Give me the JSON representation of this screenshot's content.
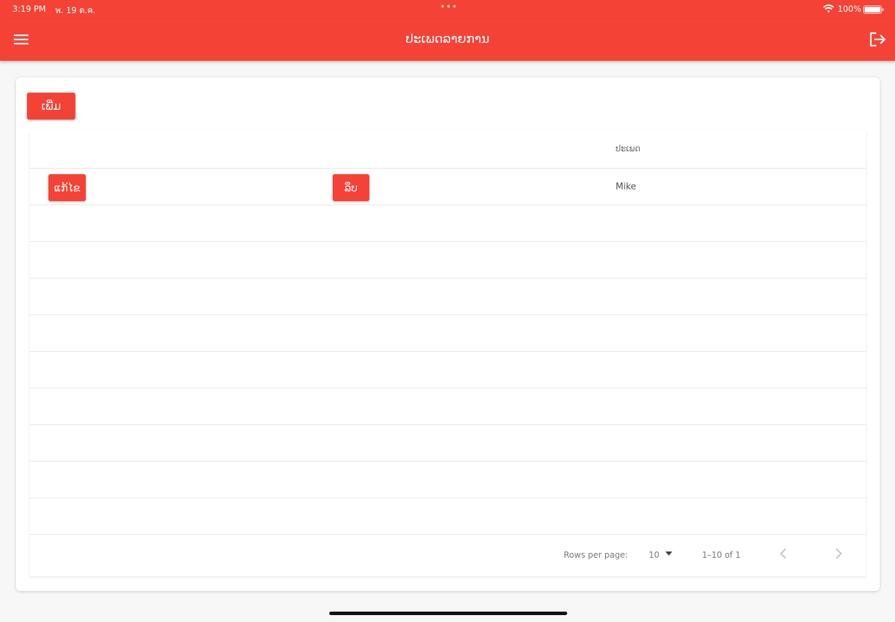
{
  "status_bar": {
    "time": "3:19 PM",
    "date": "พ. 19 ต.ค.",
    "dots": "•••",
    "battery": "100%",
    "icons": [
      "wifi-icon",
      "battery-icon"
    ]
  },
  "app_bar": {
    "title": "ປະເພດລາຍການ",
    "icons": [
      "menu-icon",
      "logout-icon"
    ],
    "color": "#f44336"
  },
  "actions": {
    "add_label": "ເພີ່ມ"
  },
  "table": {
    "columns": [
      "",
      "",
      "ປະເພດ"
    ],
    "rows": [
      {
        "edit_label": "ແກ້ໄຂ",
        "delete_label": "ລຶບ",
        "name": "Mike"
      }
    ],
    "footer": {
      "rows_per_page_label": "Rows per page:",
      "rows_per_page_value": "10",
      "range": "1–10 of 1",
      "icons": [
        "chevron-left-icon",
        "chevron-right-icon",
        "caret-down-icon"
      ]
    }
  },
  "colors": {
    "accent": "#f44336",
    "background": "#f7f7f7",
    "card": "#ffffff"
  }
}
